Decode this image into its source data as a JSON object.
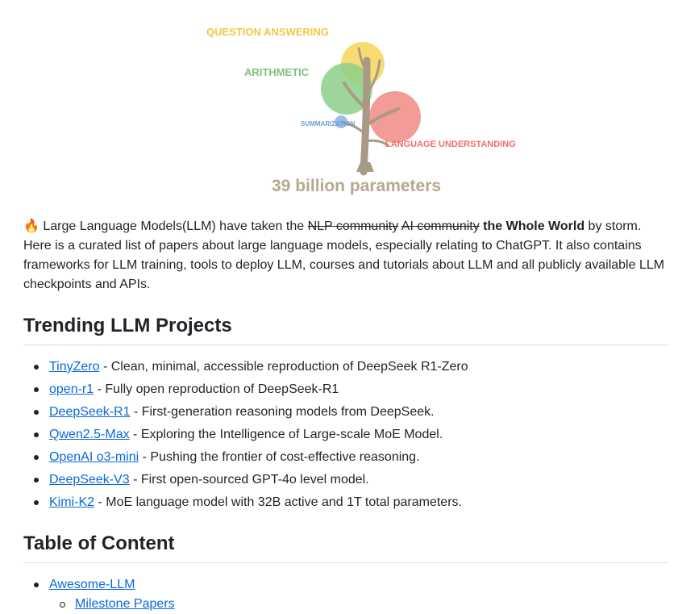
{
  "hero": {
    "labels": {
      "question_answering": "QUESTION ANSWERING",
      "arithmetic": "ARITHMETIC",
      "summarization": "SUMMARIZATION",
      "language_understanding": "LANGUAGE UNDERSTANDING",
      "parameters": "39 billion parameters"
    },
    "colors": {
      "yellow": "#f6d65c",
      "green": "#8ccf8a",
      "blue": "#8fb6e8",
      "red": "#f08a85",
      "trunk": "#a89a85",
      "parameters_text": "#b7a890"
    }
  },
  "intro": {
    "emoji": "🔥",
    "text_before": " Large Language Models(LLM) have taken the ",
    "strike_1": "NLP community",
    "strike_2": "AI community",
    "bold": "the Whole World",
    "text_after": " by storm. Here is a curated list of papers about large language models, especially relating to ChatGPT. It also contains frameworks for LLM training, tools to deploy LLM, courses and tutorials about LLM and all publicly available LLM checkpoints and APIs."
  },
  "trending": {
    "heading": "Trending LLM Projects",
    "items": [
      {
        "link": "TinyZero",
        "desc": " - Clean, minimal, accessible reproduction of DeepSeek R1-Zero"
      },
      {
        "link": "open-r1",
        "desc": " - Fully open reproduction of DeepSeek-R1"
      },
      {
        "link": "DeepSeek-R1",
        "desc": " - First-generation reasoning models from DeepSeek."
      },
      {
        "link": "Qwen2.5-Max",
        "desc": " - Exploring the Intelligence of Large-scale MoE Model."
      },
      {
        "link": "OpenAI o3-mini",
        "desc": " - Pushing the frontier of cost-effective reasoning."
      },
      {
        "link": "DeepSeek-V3",
        "desc": " - First open-sourced GPT-4o level model."
      },
      {
        "link": "Kimi-K2",
        "desc": " - MoE language model with 32B active and 1T total parameters."
      }
    ]
  },
  "toc": {
    "heading": "Table of Content",
    "items": [
      {
        "label": "Awesome-LLM",
        "children": [
          "Milestone Papers"
        ]
      }
    ]
  }
}
